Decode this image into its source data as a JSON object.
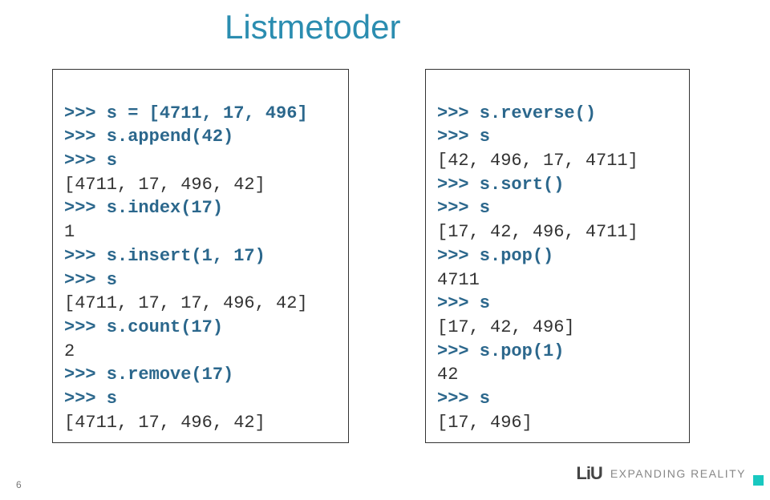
{
  "title": "Listmetoder",
  "left": {
    "l1": ">>> s = [4711, 17, 496]",
    "l2": ">>> s.append(42)",
    "l3": ">>> s",
    "l4": "[4711, 17, 496, 42]",
    "l5": ">>> s.index(17)",
    "l6": "1",
    "l7": ">>> s.insert(1, 17)",
    "l8": ">>> s",
    "l9": "[4711, 17, 17, 496, 42]",
    "l10": ">>> s.count(17)",
    "l11": "2",
    "l12": ">>> s.remove(17)",
    "l13": ">>> s",
    "l14": "[4711, 17, 496, 42]"
  },
  "right": {
    "l1": ">>> s.reverse()",
    "l2": ">>> s",
    "l3": "[42, 496, 17, 4711]",
    "l4": ">>> s.sort()",
    "l5": ">>> s",
    "l6": "[17, 42, 496, 4711]",
    "l7": ">>> s.pop()",
    "l8": "4711",
    "l9": ">>> s",
    "l10": "[17, 42, 496]",
    "l11": ">>> s.pop(1)",
    "l12": "42",
    "l13": ">>> s",
    "l14": "[17, 496]"
  },
  "footer": {
    "logo": "LiU",
    "tagline": "EXPANDING REALITY"
  },
  "page": "6"
}
